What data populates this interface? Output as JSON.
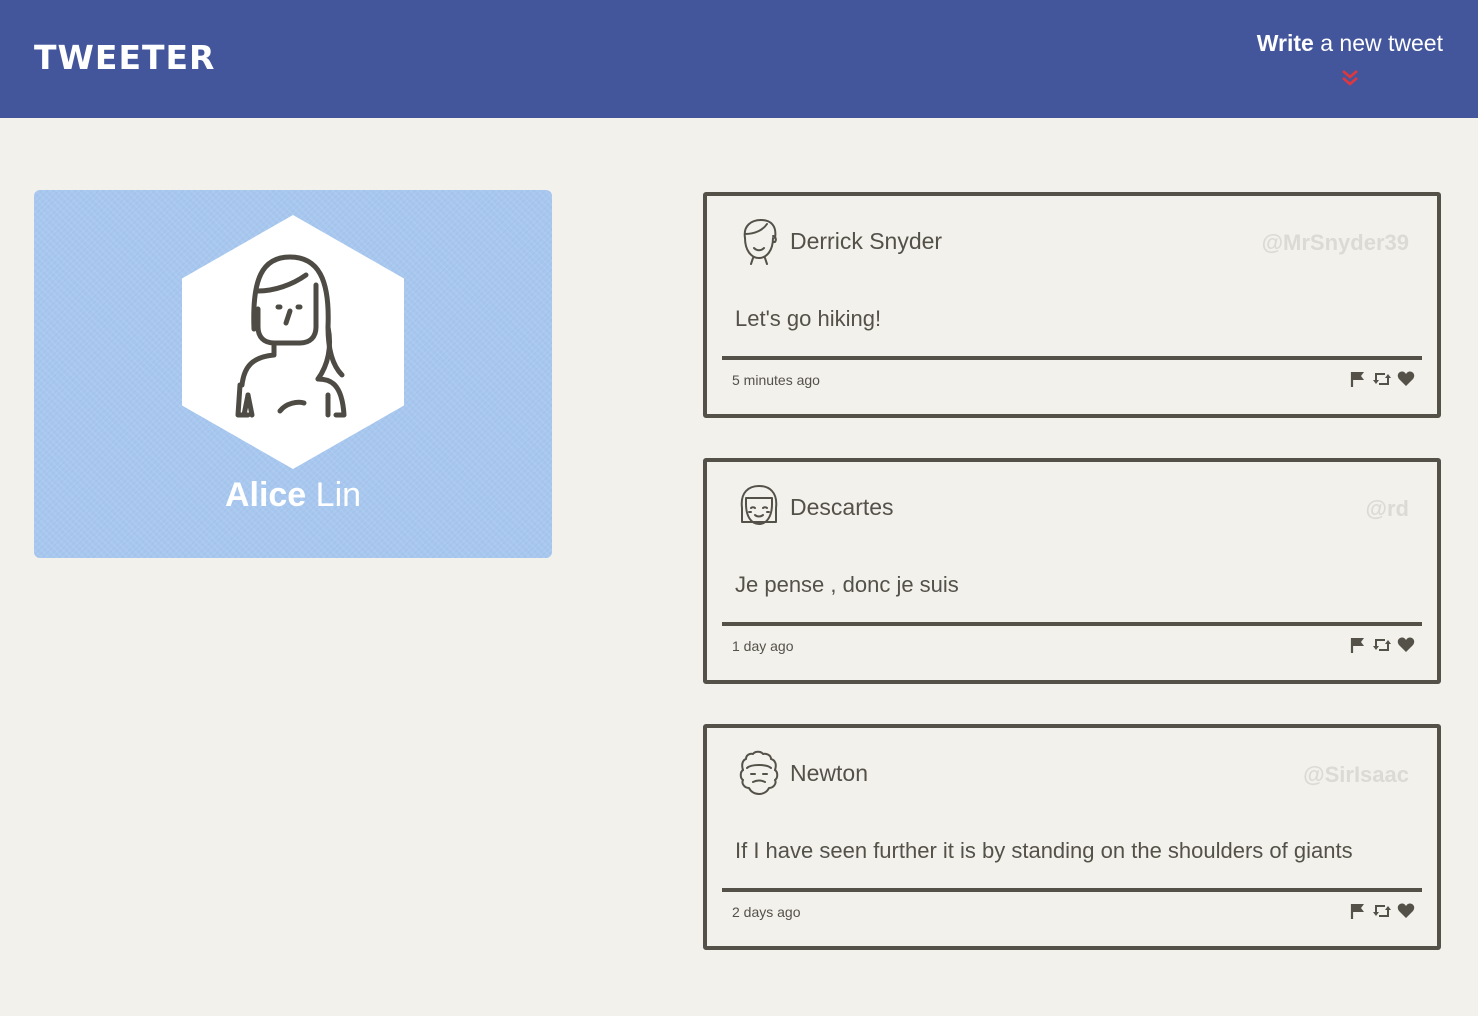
{
  "nav": {
    "logo": "TWEETER",
    "compose_bold": "Write",
    "compose_rest": " a new tweet",
    "compose_icon": "double-chevron-down-icon",
    "compose_icon_color": "#e0373f"
  },
  "profile": {
    "first_name": "Alice",
    "last_name": " Lin",
    "avatar_icon": "woman-avatar-icon",
    "card_color": "#a7c7ef"
  },
  "tweets": [
    {
      "author": "Derrick Snyder",
      "handle": "@MrSnyder39",
      "content": "Let's go hiking!",
      "time": "5 minutes ago",
      "avatar_icon": "man-avatar-icon"
    },
    {
      "author": "Descartes",
      "handle": "@rd",
      "content": "Je pense , donc je suis",
      "time": "1 day ago",
      "avatar_icon": "bangs-avatar-icon"
    },
    {
      "author": "Newton",
      "handle": "@SirIsaac",
      "content": "If I have seen further it is by standing on the shoulders of giants",
      "time": "2 days ago",
      "avatar_icon": "curly-hair-avatar-icon"
    }
  ],
  "actions": {
    "flag_icon": "flag-icon",
    "retweet_icon": "retweet-icon",
    "like_icon": "heart-icon"
  },
  "colors": {
    "nav_bg": "#43569b",
    "page_bg": "#f3f1ec",
    "text": "#545149",
    "handle": "#dcdad5"
  }
}
